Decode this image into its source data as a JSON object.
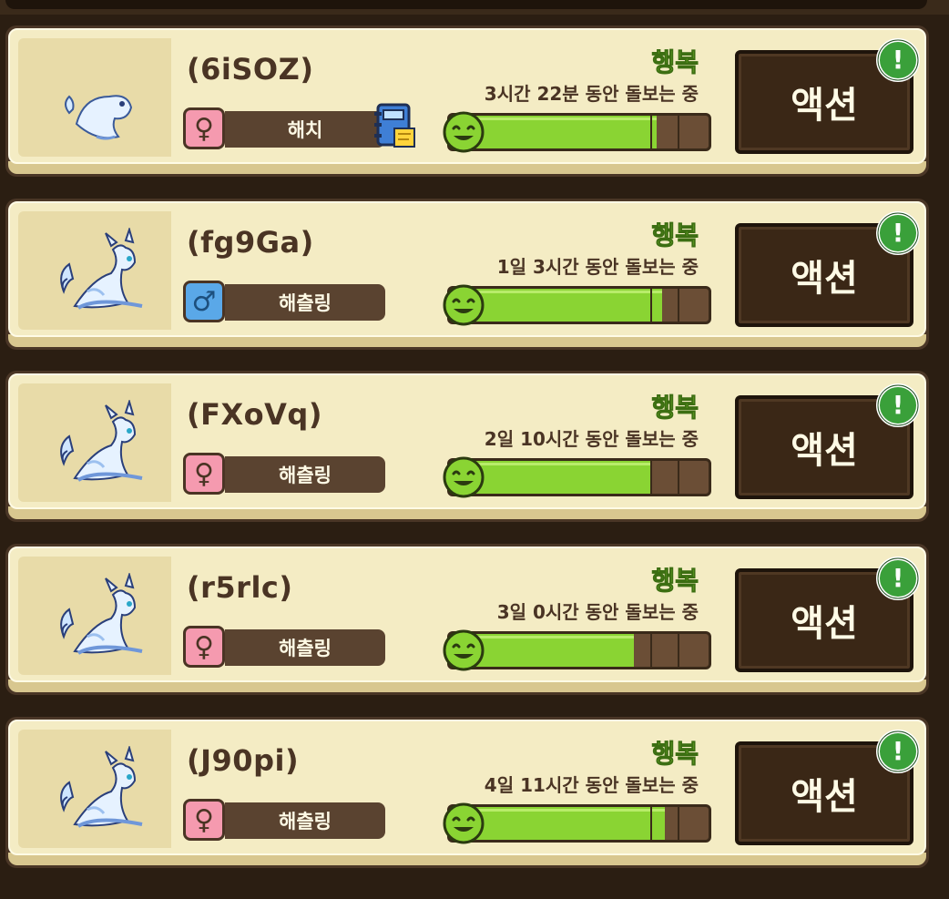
{
  "cards": [
    {
      "name": "(6iSOZ)",
      "gender": "female",
      "gender_symbol": "♀",
      "stage": "해치",
      "has_note": true,
      "happy": "행복",
      "care_time": "3시간 22분 동안 돌보는 중",
      "happiness": 0.8,
      "action": "액션",
      "alert": "!"
    },
    {
      "name": "(fg9Ga)",
      "gender": "male",
      "gender_symbol": "♂",
      "stage": "해츨링",
      "has_note": false,
      "happy": "행복",
      "care_time": "1일 3시간 동안 돌보는 중",
      "happiness": 0.82,
      "action": "액션",
      "alert": "!"
    },
    {
      "name": "(FXoVq)",
      "gender": "female",
      "gender_symbol": "♀",
      "stage": "해츨링",
      "has_note": false,
      "happy": "행복",
      "care_time": "2일 10시간 동안 돌보는 중",
      "happiness": 0.78,
      "action": "액션",
      "alert": "!"
    },
    {
      "name": "(r5rlc)",
      "gender": "female",
      "gender_symbol": "♀",
      "stage": "해츨링",
      "has_note": false,
      "happy": "행복",
      "care_time": "3일 0시간 동안 돌보는 중",
      "happiness": 0.71,
      "action": "액션",
      "alert": "!"
    },
    {
      "name": "(J90pi)",
      "gender": "female",
      "gender_symbol": "♀",
      "stage": "해츨링",
      "has_note": false,
      "happy": "행복",
      "care_time": "4일 11시간 동안 돌보는 중",
      "happiness": 0.83,
      "action": "액션",
      "alert": "!"
    }
  ],
  "colors": {
    "happy_green": "#8ad433",
    "panel": "#f4ecc4",
    "frame": "#4a3626"
  }
}
